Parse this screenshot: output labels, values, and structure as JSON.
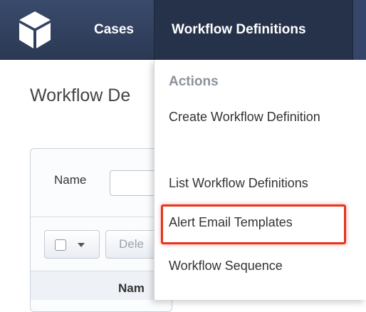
{
  "navbar": {
    "logo_icon": "cube-icon",
    "tabs": [
      {
        "label": "Cases"
      },
      {
        "label": "Workflow Definitions"
      }
    ]
  },
  "page": {
    "title": "Workflow De"
  },
  "search": {
    "name_label": "Name"
  },
  "toolbar": {
    "delete_label": "Dele"
  },
  "table": {
    "column_header": "Nam"
  },
  "dropdown": {
    "heading": "Actions",
    "items": [
      {
        "label": "Create Workflow Definition"
      },
      {
        "label": "List Workflow Definitions"
      },
      {
        "label": "Alert Email Templates"
      },
      {
        "label": "Workflow Sequence"
      }
    ]
  },
  "colors": {
    "navbar": "#2f3d5a",
    "highlight": "#e8341c"
  }
}
